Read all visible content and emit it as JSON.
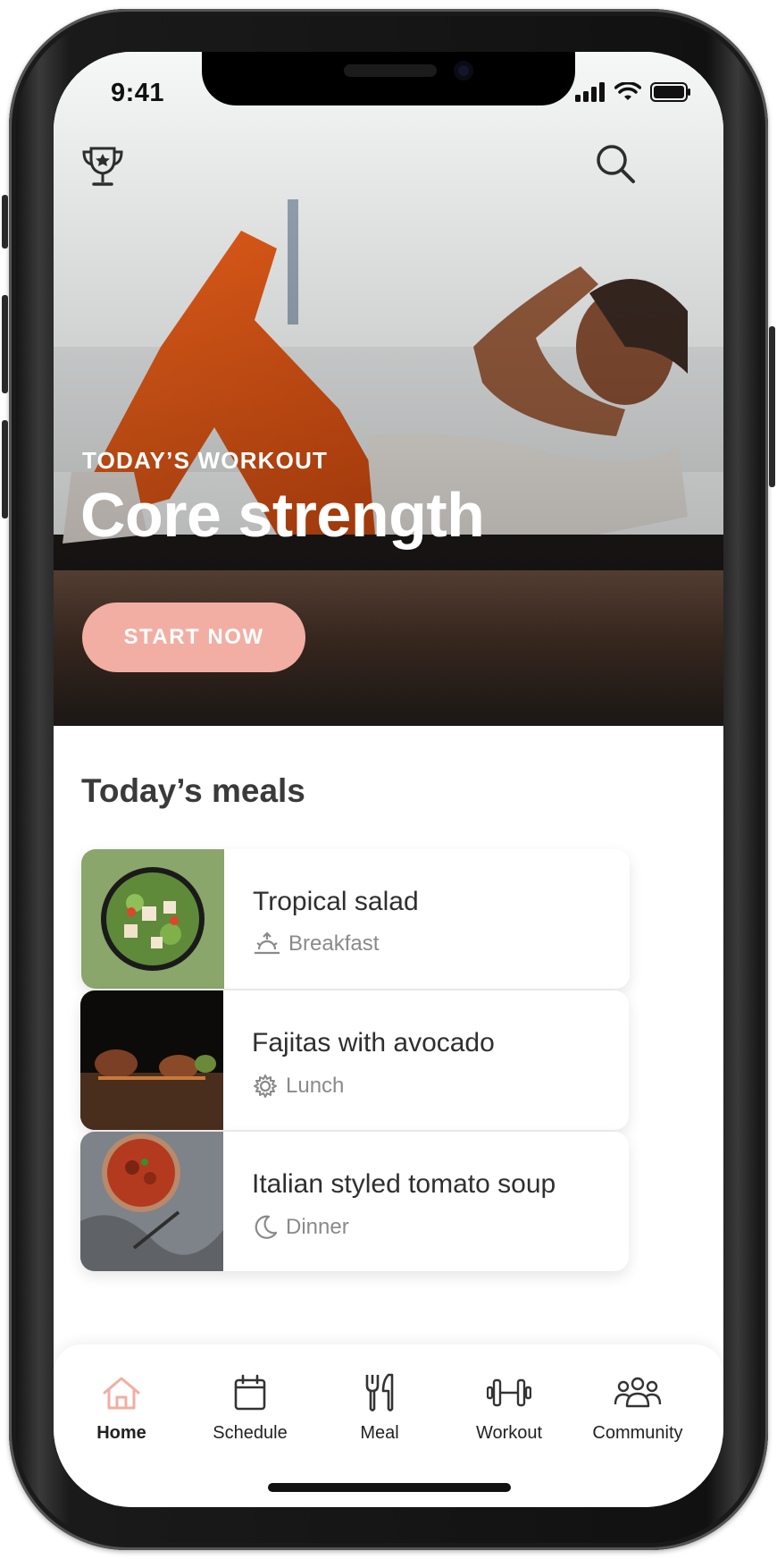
{
  "status_bar": {
    "time": "9:41"
  },
  "header": {
    "left_icon": "trophy-icon",
    "right_icon": "search-icon"
  },
  "hero": {
    "eyebrow": "TODAY’S WORKOUT",
    "title": "Core strength",
    "button_label": "START NOW"
  },
  "meals": {
    "section_title": "Today’s meals",
    "items": [
      {
        "name": "Tropical salad",
        "type": "Breakfast",
        "icon": "sunrise-icon"
      },
      {
        "name": "Fajitas with avocado",
        "type": "Lunch",
        "icon": "sun-gear-icon"
      },
      {
        "name": "Italian styled tomato soup",
        "type": "Dinner",
        "icon": "moon-icon"
      }
    ]
  },
  "tab_bar": {
    "tabs": [
      {
        "label": "Home",
        "icon": "home-icon",
        "active": true
      },
      {
        "label": "Schedule",
        "icon": "calendar-icon",
        "active": false
      },
      {
        "label": "Meal",
        "icon": "utensils-icon",
        "active": false
      },
      {
        "label": "Workout",
        "icon": "dumbbell-icon",
        "active": false
      },
      {
        "label": "Community",
        "icon": "people-icon",
        "active": false
      }
    ]
  },
  "colors": {
    "accent": "#f2aea2",
    "text_dark": "#2f2f2f",
    "text_muted": "#8a8a8a"
  }
}
